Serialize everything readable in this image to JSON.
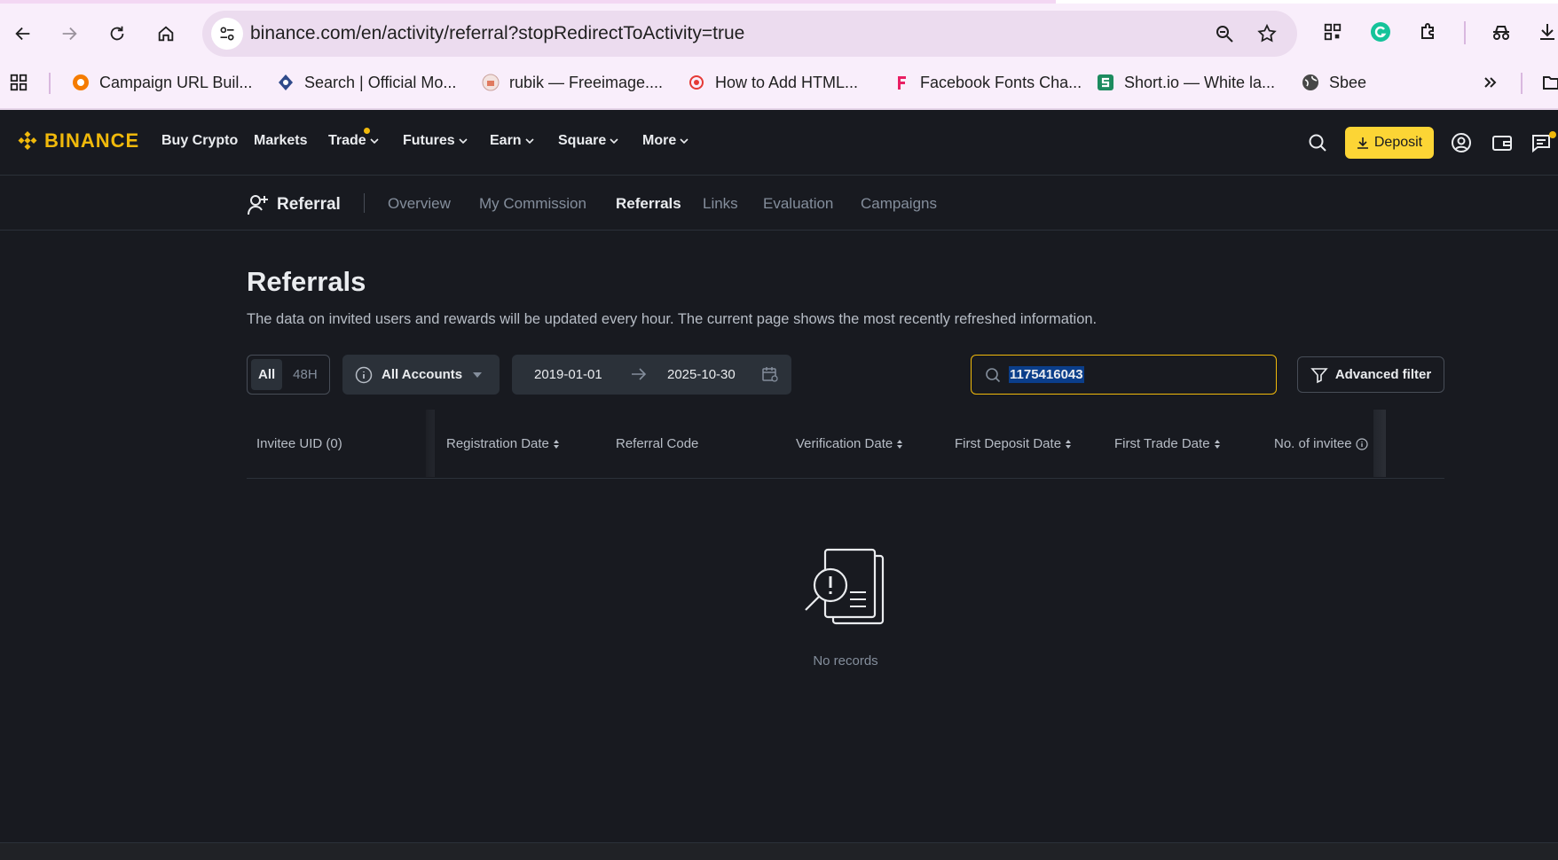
{
  "browser": {
    "url": "binance.com/en/activity/referral?stopRedirectToActivity=true",
    "bookmarks": [
      {
        "label": "Campaign URL Buil...",
        "icon": "campaign-url-builder-icon"
      },
      {
        "label": "Search | Official Mo...",
        "icon": "search-official-icon"
      },
      {
        "label": "rubik — Freeimage....",
        "icon": "freeimage-icon"
      },
      {
        "label": "How to Add HTML...",
        "icon": "html-icon"
      },
      {
        "label": "Facebook Fonts Cha...",
        "icon": "facebook-fonts-icon"
      },
      {
        "label": "Short.io — White la...",
        "icon": "short-io-icon"
      },
      {
        "label": "Sbee",
        "icon": "globe-icon"
      }
    ]
  },
  "header": {
    "logo": "BINANCE",
    "nav": [
      "Buy Crypto",
      "Markets",
      "Trade",
      "Futures",
      "Earn",
      "Square",
      "More"
    ],
    "deposit_label": "Deposit",
    "brand_color": "#f0b90b"
  },
  "subnav": {
    "title": "Referral",
    "items": [
      "Overview",
      "My Commission",
      "Referrals",
      "Links",
      "Evaluation",
      "Campaigns"
    ],
    "active": "Referrals"
  },
  "main": {
    "title": "Referrals",
    "description": "The data on invited users and rewards will be updated every hour. The current page shows the most recently refreshed information.",
    "filters": {
      "period_all": "All",
      "period_48h": "48H",
      "account": "All Accounts",
      "date_from": "2019-01-01",
      "date_to": "2025-10-30",
      "search_value": "1175416043",
      "advanced_filter": "Advanced filter"
    },
    "table": {
      "columns": [
        "Invitee UID (0)",
        "Registration Date",
        "Referral Code",
        "Verification Date",
        "First Deposit Date",
        "First Trade Date",
        "No. of invitee"
      ]
    },
    "empty_text": "No records"
  }
}
